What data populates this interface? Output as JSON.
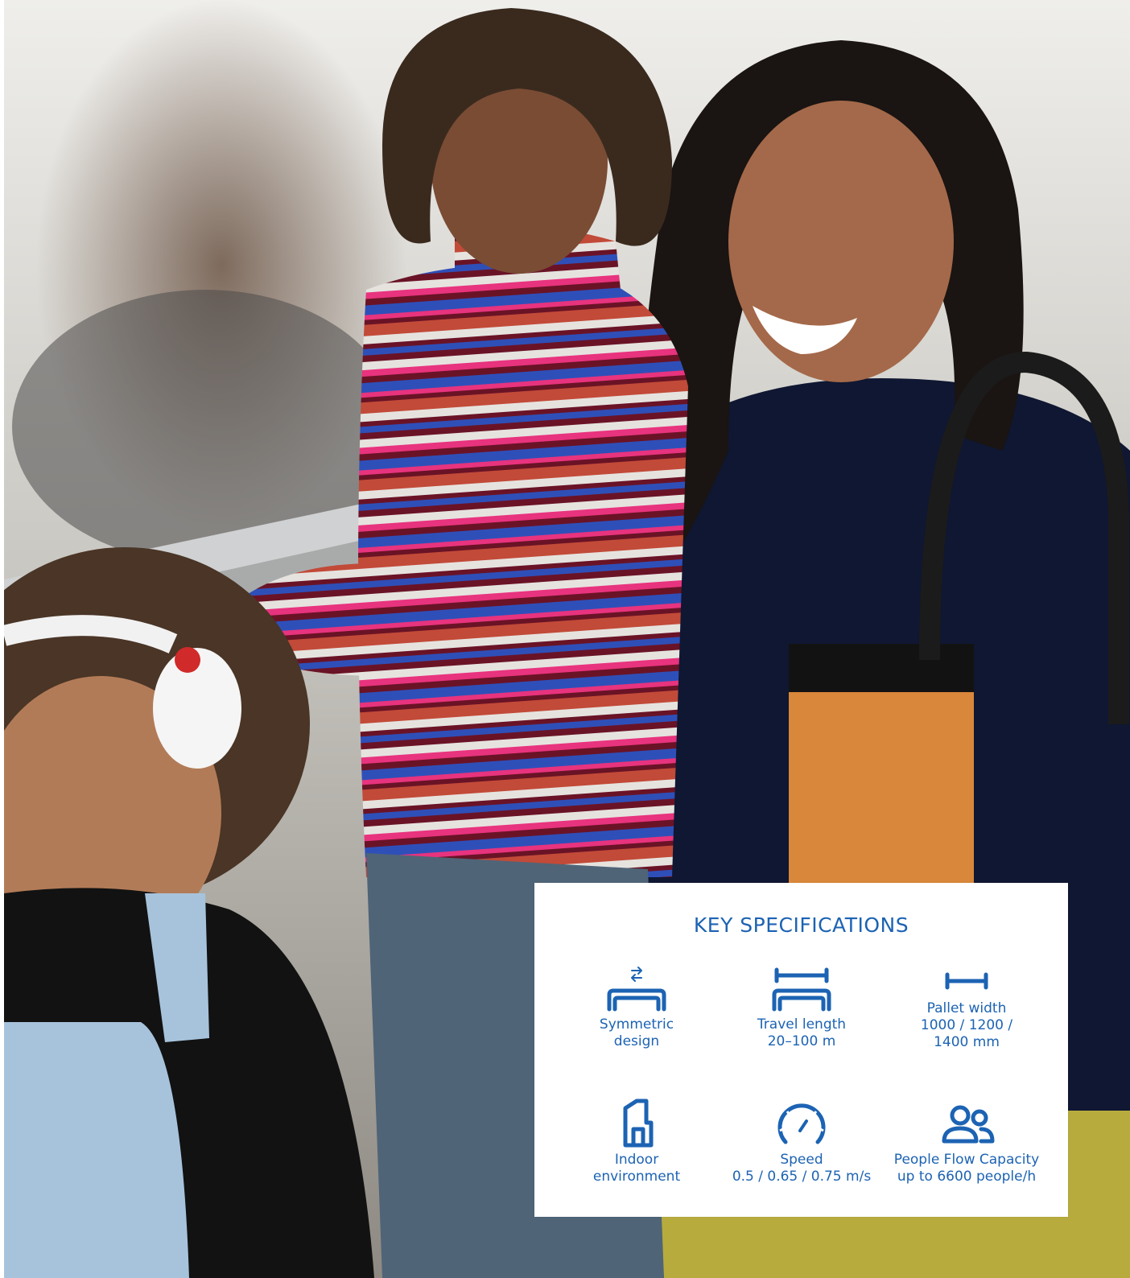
{
  "key_specifications": {
    "title": "KEY SPECIFICATIONS",
    "items": [
      {
        "label": "Symmetric\ndesign",
        "icon": "symmetric-design-icon"
      },
      {
        "label": "Travel length\n20–100 m",
        "icon": "travel-length-icon"
      },
      {
        "label": "Pallet width\n1000 / 1200 /\n1400 mm",
        "icon": "pallet-width-icon"
      },
      {
        "label": "Indoor\nenvironment",
        "icon": "indoor-environment-icon"
      },
      {
        "label": "Speed\n0.5 / 0.65 / 0.75 m/s",
        "icon": "speedometer-icon"
      },
      {
        "label": "People Flow Capacity\nup to 6600 people/h",
        "icon": "people-flow-icon"
      }
    ]
  },
  "colors": {
    "accent": "#1c63b3",
    "card_background": "#ffffff"
  }
}
